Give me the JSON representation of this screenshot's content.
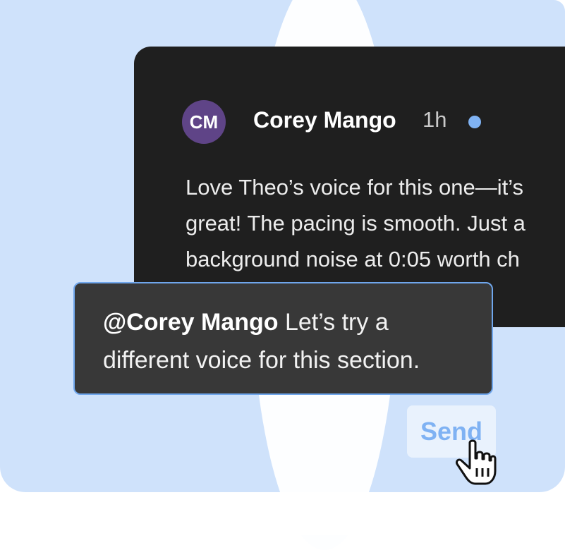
{
  "comment": {
    "avatar_initials": "CM",
    "author": "Corey Mango",
    "time": "1h",
    "unread_indicator_color": "#7fb2f3",
    "avatar_color": "#5f4487",
    "body_lines": [
      "Love Theo’s voice for this one—it’s",
      "great! The pacing is smooth. Just a",
      "background noise at 0:05 worth ch"
    ]
  },
  "reply": {
    "mention": "@Corey Mango",
    "text_line1": " Let’s try a",
    "text_line2": "different voice for this section."
  },
  "send_button": {
    "label": "Send"
  },
  "cursor": {
    "icon": "pointer-hand-icon"
  }
}
